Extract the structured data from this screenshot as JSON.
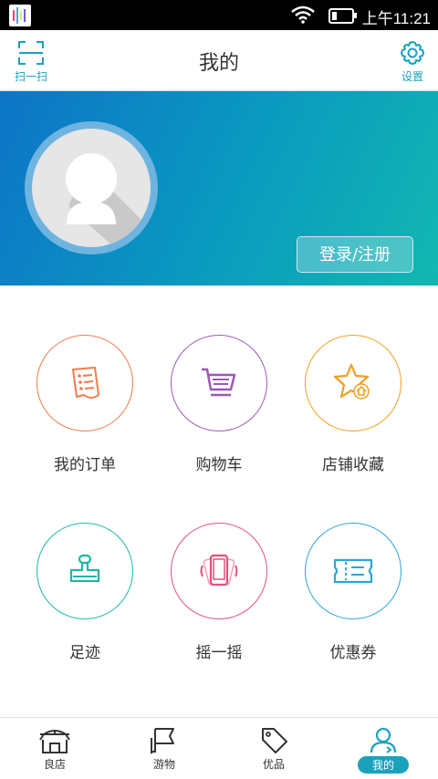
{
  "status_bar": {
    "time": "上午11:21"
  },
  "header": {
    "title": "我的",
    "scan_label": "扫一扫",
    "settings_label": "设置"
  },
  "profile": {
    "login_label": "登录/注册"
  },
  "grid": [
    {
      "label": "我的订单",
      "color": "#f07b4c"
    },
    {
      "label": "购物车",
      "color": "#9b59b6"
    },
    {
      "label": "店铺收藏",
      "color": "#f0a020"
    },
    {
      "label": "足迹",
      "color": "#1bb7a6"
    },
    {
      "label": "摇一摇",
      "color": "#e0527a"
    },
    {
      "label": "优惠券",
      "color": "#2aa6d8"
    }
  ],
  "tabs": [
    {
      "label": "良店"
    },
    {
      "label": "游物"
    },
    {
      "label": "优品"
    },
    {
      "label": "我的",
      "active": true
    }
  ],
  "colors": {
    "accent": "#1aa2bc"
  }
}
